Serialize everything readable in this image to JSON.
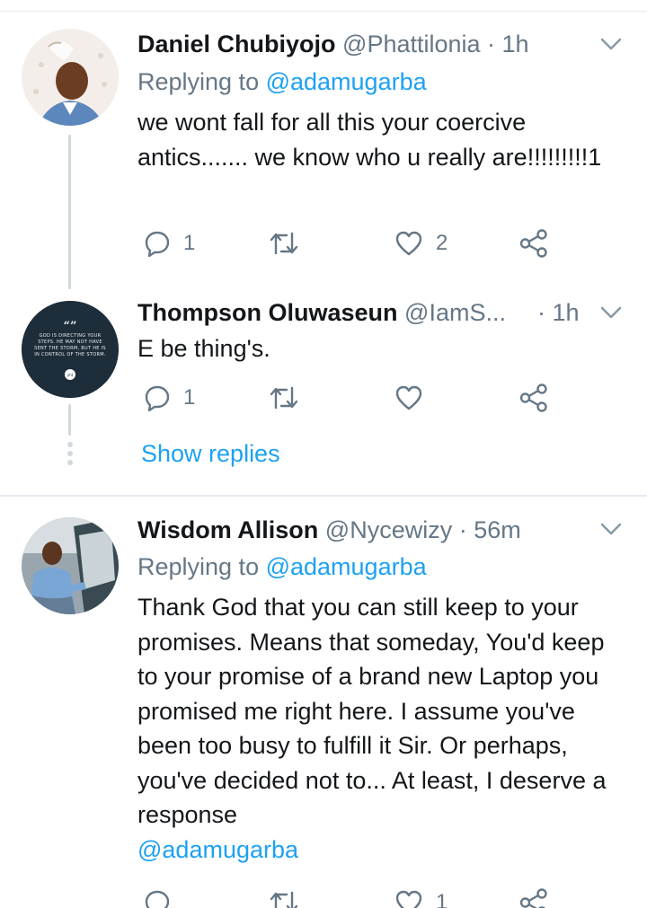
{
  "tweets": [
    {
      "name": "Daniel Chubiyojo",
      "handle": "@Phattilonia",
      "time": "· 1h",
      "replying_prefix": "Replying to ",
      "replying_to": "@adamugarba",
      "text": "we wont fall for all this your coercive antics....... we know who u really are!!!!!!!!!1",
      "reply_count": "1",
      "retweet_count": "",
      "like_count": "2"
    },
    {
      "name": "Thompson Oluwaseun",
      "handle": "@IamS...",
      "time": "· 1h",
      "text": "E be thing's.",
      "reply_count": "1",
      "retweet_count": "",
      "like_count": "",
      "avatar_quote_mark": "“”",
      "avatar_text": "GOD IS DIRECTING YOUR STEPS. HE MAY NOT HAVE SENT THE STORM, BUT HE IS IN CONTROL OF THE STORM.",
      "avatar_badge": "jmt"
    },
    {
      "name": "Wisdom Allison",
      "handle": "@Nycewizy",
      "time": "· 56m",
      "replying_prefix": "Replying to ",
      "replying_to": "@adamugarba",
      "text": "Thank God that you can still keep to your promises. Means that someday, You'd keep to your promise of a brand new Laptop you promised me right here. I assume you've been too busy to fulfill it Sir. Or perhaps, you've decided not to... At least, I deserve a response",
      "text_mention": "@adamugarba",
      "reply_count": "",
      "retweet_count": "",
      "like_count": "1"
    }
  ],
  "show_replies_label": "Show replies",
  "colors": {
    "accent": "#1da1f2",
    "secondary_text": "#657786",
    "primary_text": "#14171a",
    "divider": "#e6ecf0"
  },
  "icons": [
    "reply-icon",
    "retweet-icon",
    "like-icon",
    "share-icon",
    "chevron-down-icon"
  ]
}
